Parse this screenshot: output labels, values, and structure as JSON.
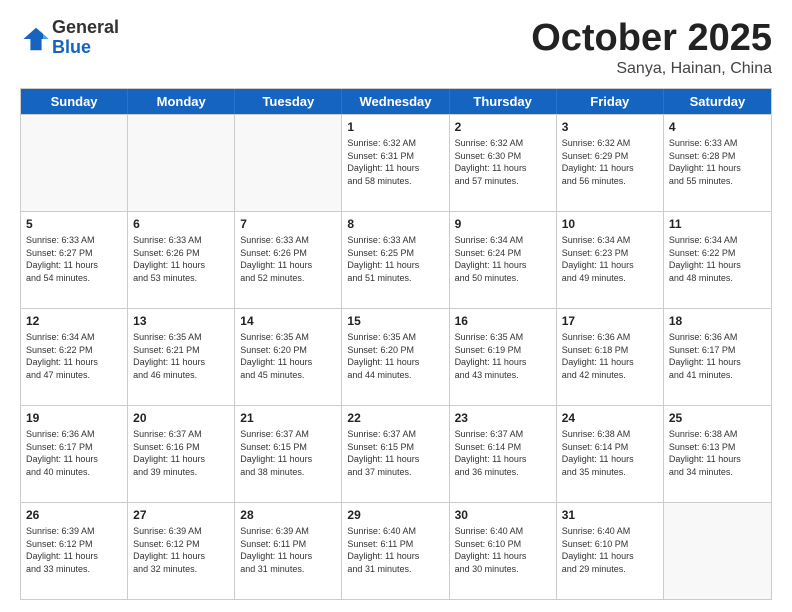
{
  "header": {
    "logo_general": "General",
    "logo_blue": "Blue",
    "month_title": "October 2025",
    "location": "Sanya, Hainan, China"
  },
  "days_of_week": [
    "Sunday",
    "Monday",
    "Tuesday",
    "Wednesday",
    "Thursday",
    "Friday",
    "Saturday"
  ],
  "weeks": [
    [
      {
        "day": "",
        "info": ""
      },
      {
        "day": "",
        "info": ""
      },
      {
        "day": "",
        "info": ""
      },
      {
        "day": "1",
        "info": "Sunrise: 6:32 AM\nSunset: 6:31 PM\nDaylight: 11 hours\nand 58 minutes."
      },
      {
        "day": "2",
        "info": "Sunrise: 6:32 AM\nSunset: 6:30 PM\nDaylight: 11 hours\nand 57 minutes."
      },
      {
        "day": "3",
        "info": "Sunrise: 6:32 AM\nSunset: 6:29 PM\nDaylight: 11 hours\nand 56 minutes."
      },
      {
        "day": "4",
        "info": "Sunrise: 6:33 AM\nSunset: 6:28 PM\nDaylight: 11 hours\nand 55 minutes."
      }
    ],
    [
      {
        "day": "5",
        "info": "Sunrise: 6:33 AM\nSunset: 6:27 PM\nDaylight: 11 hours\nand 54 minutes."
      },
      {
        "day": "6",
        "info": "Sunrise: 6:33 AM\nSunset: 6:26 PM\nDaylight: 11 hours\nand 53 minutes."
      },
      {
        "day": "7",
        "info": "Sunrise: 6:33 AM\nSunset: 6:26 PM\nDaylight: 11 hours\nand 52 minutes."
      },
      {
        "day": "8",
        "info": "Sunrise: 6:33 AM\nSunset: 6:25 PM\nDaylight: 11 hours\nand 51 minutes."
      },
      {
        "day": "9",
        "info": "Sunrise: 6:34 AM\nSunset: 6:24 PM\nDaylight: 11 hours\nand 50 minutes."
      },
      {
        "day": "10",
        "info": "Sunrise: 6:34 AM\nSunset: 6:23 PM\nDaylight: 11 hours\nand 49 minutes."
      },
      {
        "day": "11",
        "info": "Sunrise: 6:34 AM\nSunset: 6:22 PM\nDaylight: 11 hours\nand 48 minutes."
      }
    ],
    [
      {
        "day": "12",
        "info": "Sunrise: 6:34 AM\nSunset: 6:22 PM\nDaylight: 11 hours\nand 47 minutes."
      },
      {
        "day": "13",
        "info": "Sunrise: 6:35 AM\nSunset: 6:21 PM\nDaylight: 11 hours\nand 46 minutes."
      },
      {
        "day": "14",
        "info": "Sunrise: 6:35 AM\nSunset: 6:20 PM\nDaylight: 11 hours\nand 45 minutes."
      },
      {
        "day": "15",
        "info": "Sunrise: 6:35 AM\nSunset: 6:20 PM\nDaylight: 11 hours\nand 44 minutes."
      },
      {
        "day": "16",
        "info": "Sunrise: 6:35 AM\nSunset: 6:19 PM\nDaylight: 11 hours\nand 43 minutes."
      },
      {
        "day": "17",
        "info": "Sunrise: 6:36 AM\nSunset: 6:18 PM\nDaylight: 11 hours\nand 42 minutes."
      },
      {
        "day": "18",
        "info": "Sunrise: 6:36 AM\nSunset: 6:17 PM\nDaylight: 11 hours\nand 41 minutes."
      }
    ],
    [
      {
        "day": "19",
        "info": "Sunrise: 6:36 AM\nSunset: 6:17 PM\nDaylight: 11 hours\nand 40 minutes."
      },
      {
        "day": "20",
        "info": "Sunrise: 6:37 AM\nSunset: 6:16 PM\nDaylight: 11 hours\nand 39 minutes."
      },
      {
        "day": "21",
        "info": "Sunrise: 6:37 AM\nSunset: 6:15 PM\nDaylight: 11 hours\nand 38 minutes."
      },
      {
        "day": "22",
        "info": "Sunrise: 6:37 AM\nSunset: 6:15 PM\nDaylight: 11 hours\nand 37 minutes."
      },
      {
        "day": "23",
        "info": "Sunrise: 6:37 AM\nSunset: 6:14 PM\nDaylight: 11 hours\nand 36 minutes."
      },
      {
        "day": "24",
        "info": "Sunrise: 6:38 AM\nSunset: 6:14 PM\nDaylight: 11 hours\nand 35 minutes."
      },
      {
        "day": "25",
        "info": "Sunrise: 6:38 AM\nSunset: 6:13 PM\nDaylight: 11 hours\nand 34 minutes."
      }
    ],
    [
      {
        "day": "26",
        "info": "Sunrise: 6:39 AM\nSunset: 6:12 PM\nDaylight: 11 hours\nand 33 minutes."
      },
      {
        "day": "27",
        "info": "Sunrise: 6:39 AM\nSunset: 6:12 PM\nDaylight: 11 hours\nand 32 minutes."
      },
      {
        "day": "28",
        "info": "Sunrise: 6:39 AM\nSunset: 6:11 PM\nDaylight: 11 hours\nand 31 minutes."
      },
      {
        "day": "29",
        "info": "Sunrise: 6:40 AM\nSunset: 6:11 PM\nDaylight: 11 hours\nand 31 minutes."
      },
      {
        "day": "30",
        "info": "Sunrise: 6:40 AM\nSunset: 6:10 PM\nDaylight: 11 hours\nand 30 minutes."
      },
      {
        "day": "31",
        "info": "Sunrise: 6:40 AM\nSunset: 6:10 PM\nDaylight: 11 hours\nand 29 minutes."
      },
      {
        "day": "",
        "info": ""
      }
    ]
  ]
}
